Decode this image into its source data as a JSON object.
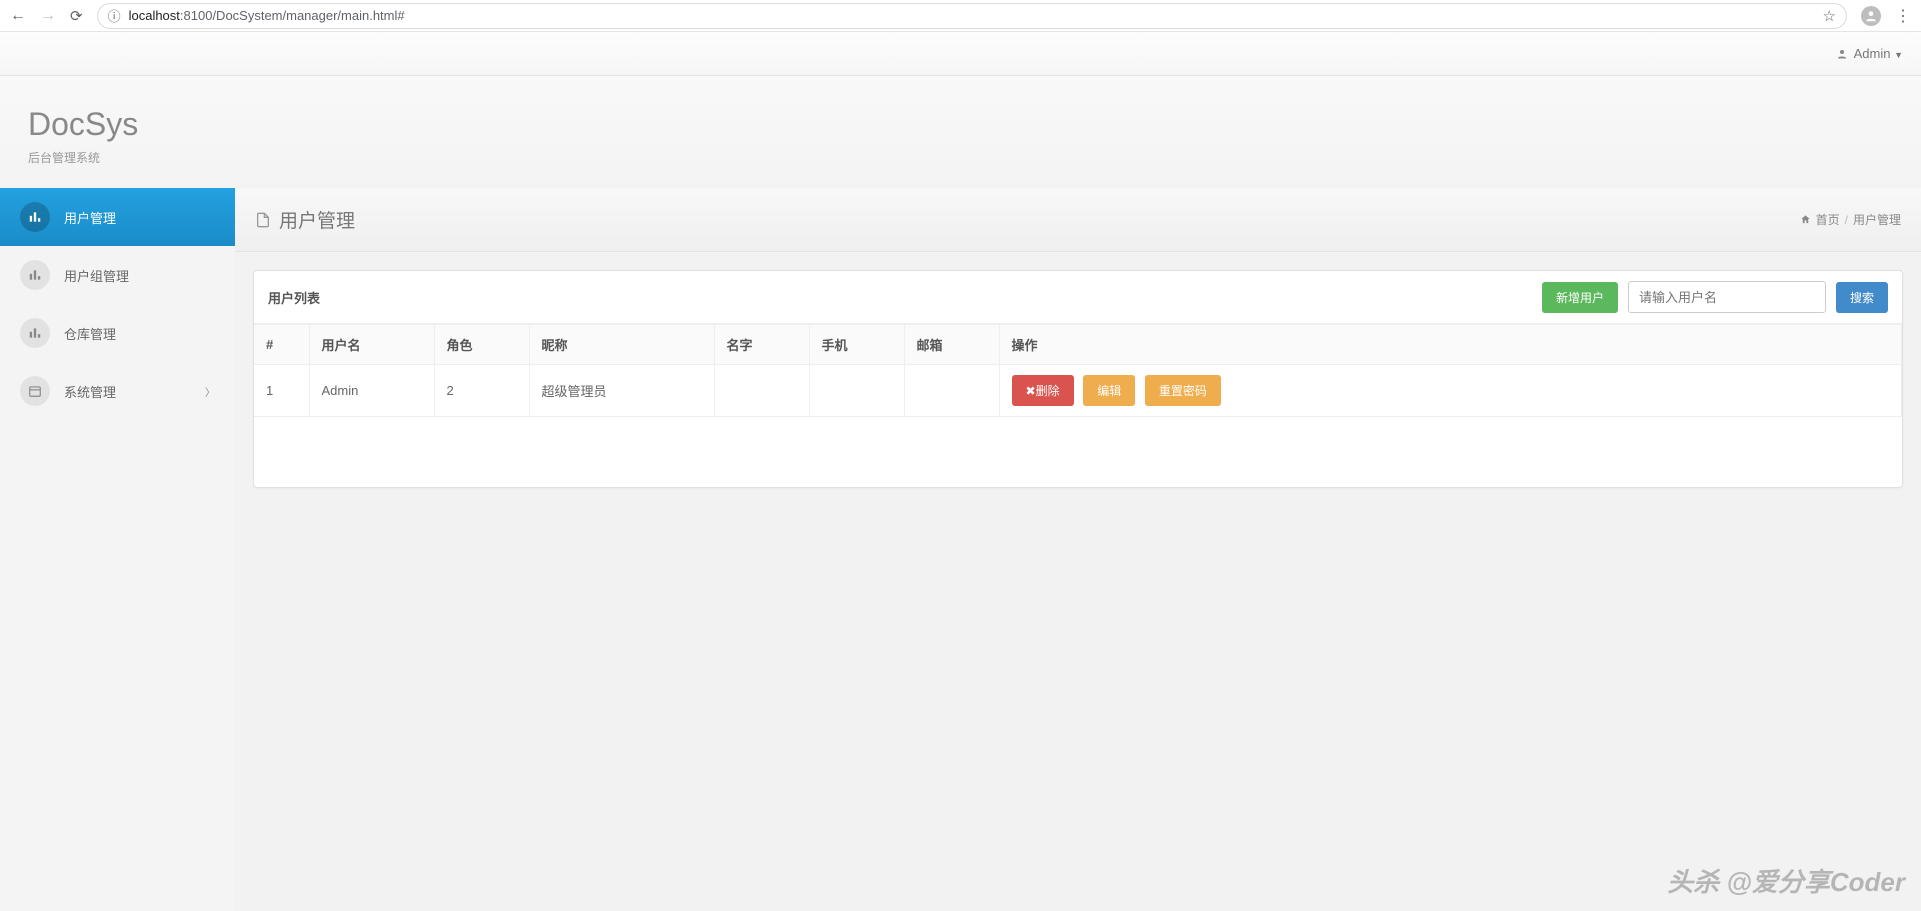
{
  "browser": {
    "url_scheme": "localhost",
    "url_port_path": ":8100/DocSystem/manager/main.html#"
  },
  "topbar": {
    "user_label": "Admin"
  },
  "logo": {
    "title": "DocSys",
    "subtitle": "后台管理系统"
  },
  "sidebar": {
    "items": [
      {
        "label": "用户管理"
      },
      {
        "label": "用户组管理"
      },
      {
        "label": "仓库管理"
      },
      {
        "label": "系统管理"
      }
    ]
  },
  "content": {
    "title": "用户管理",
    "breadcrumb": {
      "home": "首页",
      "current": "用户管理"
    }
  },
  "panel": {
    "title": "用户列表",
    "add_label": "新增用户",
    "search_placeholder": "请输入用户名",
    "search_label": "搜索",
    "columns": {
      "idx": "#",
      "username": "用户名",
      "role": "角色",
      "nickname": "昵称",
      "name": "名字",
      "phone": "手机",
      "email": "邮箱",
      "actions": "操作"
    },
    "rows": [
      {
        "idx": "1",
        "username": "Admin",
        "role": "2",
        "nickname": "超级管理员",
        "name": "",
        "phone": "",
        "email": ""
      }
    ],
    "actions": {
      "delete": "删除",
      "edit": "编辑",
      "reset": "重置密码"
    }
  },
  "watermark": "头杀 @爱分享Coder"
}
